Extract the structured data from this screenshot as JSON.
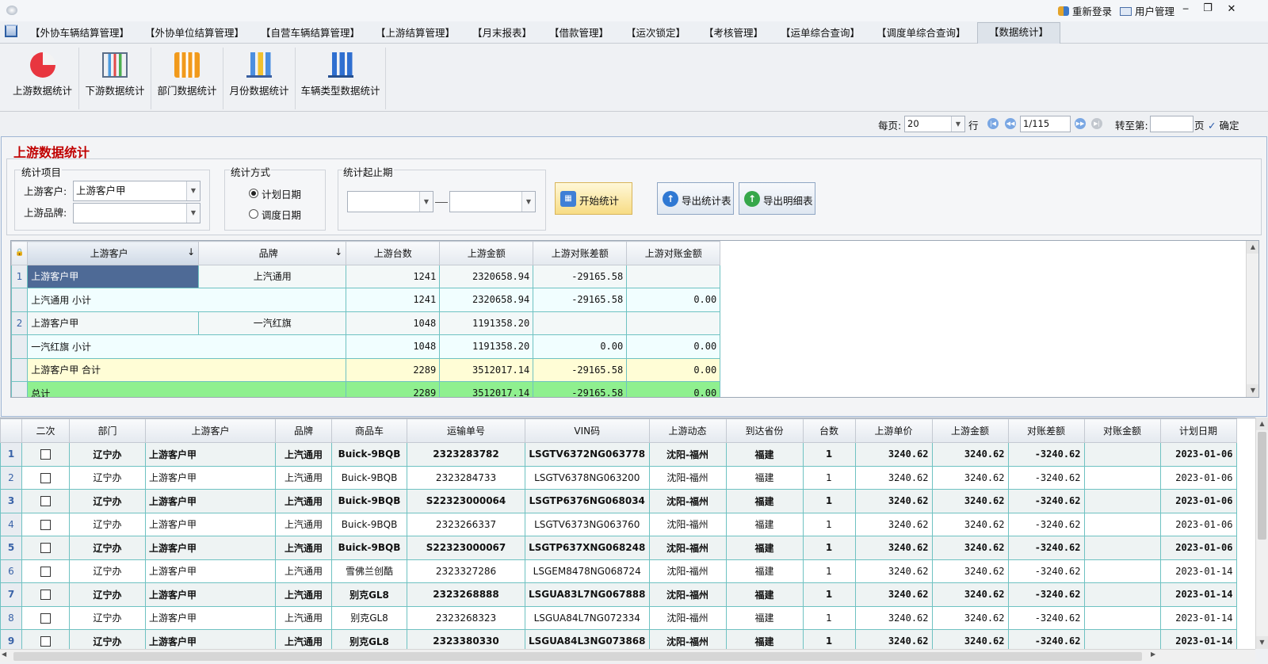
{
  "titlebar": {
    "relogin": "重新登录",
    "user_mgmt": "用户管理",
    "minimize": "─",
    "restore": "❐",
    "close": "✕"
  },
  "menu": [
    "【外协车辆结算管理】",
    "【外协单位结算管理】",
    "【自营车辆结算管理】",
    "【上游结算管理】",
    "【月末报表】",
    "【借款管理】",
    "【运次锁定】",
    "【考核管理】",
    "【运单综合查询】",
    "【调度单综合查询】",
    "【数据统计】"
  ],
  "ribbon": [
    {
      "label": "上游数据统计",
      "icon": "pie-chart-icon"
    },
    {
      "label": "下游数据统计",
      "icon": "bar-chart-icon"
    },
    {
      "label": "部门数据统计",
      "icon": "orange-bar-chart-icon"
    },
    {
      "label": "月份数据统计",
      "icon": "column-chart-icon"
    },
    {
      "label": "车辆类型数据统计",
      "icon": "blue-column-chart-icon"
    }
  ],
  "pager": {
    "per_page_label": "每页:",
    "per_page_value": "20",
    "rows_label": "行",
    "page_value": "1/115",
    "goto_label": "转至第:",
    "goto_value": "",
    "page_unit": "页",
    "confirm": "确定"
  },
  "panel": {
    "title": "上游数据统计",
    "group_items": "统计项目",
    "customer_label": "上游客户:",
    "customer_value": "上游客户甲",
    "brand_label": "上游品牌:",
    "brand_value": "",
    "group_method": "统计方式",
    "radio_plan": "计划日期",
    "radio_dispatch": "调度日期",
    "selected_method": "计划日期",
    "group_period": "统计起止期",
    "start_date": "",
    "end_date": "",
    "btn_start": "开始统计",
    "btn_export_summary": "导出统计表",
    "btn_export_detail": "导出明细表"
  },
  "summary": {
    "headers": [
      "上游客户",
      "品牌",
      "上游台数",
      "上游金额",
      "上游对账差额",
      "上游对账金额"
    ],
    "rows": [
      {
        "num": "1",
        "type": "data",
        "customer": "上游客户甲",
        "brand": "上汽通用",
        "count": "1241",
        "amount": "2320658.94",
        "diff": "-29165.58",
        "recon": ""
      },
      {
        "num": "",
        "type": "sub",
        "label": "上汽通用 小计",
        "count": "1241",
        "amount": "2320658.94",
        "diff": "-29165.58",
        "recon": "0.00"
      },
      {
        "num": "2",
        "type": "data",
        "customer": "上游客户甲",
        "brand": "一汽红旗",
        "count": "1048",
        "amount": "1191358.20",
        "diff": "",
        "recon": ""
      },
      {
        "num": "",
        "type": "sub",
        "label": "一汽红旗 小计",
        "count": "1048",
        "amount": "1191358.20",
        "diff": "0.00",
        "recon": "0.00"
      },
      {
        "num": "",
        "type": "total",
        "label": "上游客户甲 合计",
        "count": "2289",
        "amount": "3512017.14",
        "diff": "-29165.58",
        "recon": "0.00"
      },
      {
        "num": "",
        "type": "grand",
        "label": "总计",
        "count": "2289",
        "amount": "3512017.14",
        "diff": "-29165.58",
        "recon": "0.00"
      }
    ]
  },
  "detail": {
    "headers": [
      "二次",
      "部门",
      "上游客户",
      "品牌",
      "商品车",
      "运输单号",
      "VIN码",
      "上游动态",
      "到达省份",
      "台数",
      "上游单价",
      "上游金额",
      "对账差额",
      "对账金额",
      "计划日期"
    ],
    "rows": [
      {
        "n": "1",
        "dept": "辽宁办",
        "cust": "上游客户甲",
        "brand": "上汽通用",
        "car": "Buick-9BQB",
        "order": "2323283782",
        "vin": "LSGTV6372NG063778",
        "route": "沈阳-福州",
        "prov": "福建",
        "qty": "1",
        "price": "3240.62",
        "amt": "3240.62",
        "diff": "-3240.62",
        "recon": "",
        "date": "2023-01-06"
      },
      {
        "n": "2",
        "dept": "辽宁办",
        "cust": "上游客户甲",
        "brand": "上汽通用",
        "car": "Buick-9BQB",
        "order": "2323284733",
        "vin": "LSGTV6378NG063200",
        "route": "沈阳-福州",
        "prov": "福建",
        "qty": "1",
        "price": "3240.62",
        "amt": "3240.62",
        "diff": "-3240.62",
        "recon": "",
        "date": "2023-01-06"
      },
      {
        "n": "3",
        "dept": "辽宁办",
        "cust": "上游客户甲",
        "brand": "上汽通用",
        "car": "Buick-9BQB",
        "order": "S22323000064",
        "vin": "LSGTP6376NG068034",
        "route": "沈阳-福州",
        "prov": "福建",
        "qty": "1",
        "price": "3240.62",
        "amt": "3240.62",
        "diff": "-3240.62",
        "recon": "",
        "date": "2023-01-06"
      },
      {
        "n": "4",
        "dept": "辽宁办",
        "cust": "上游客户甲",
        "brand": "上汽通用",
        "car": "Buick-9BQB",
        "order": "2323266337",
        "vin": "LSGTV6373NG063760",
        "route": "沈阳-福州",
        "prov": "福建",
        "qty": "1",
        "price": "3240.62",
        "amt": "3240.62",
        "diff": "-3240.62",
        "recon": "",
        "date": "2023-01-06"
      },
      {
        "n": "5",
        "dept": "辽宁办",
        "cust": "上游客户甲",
        "brand": "上汽通用",
        "car": "Buick-9BQB",
        "order": "S22323000067",
        "vin": "LSGTP637XNG068248",
        "route": "沈阳-福州",
        "prov": "福建",
        "qty": "1",
        "price": "3240.62",
        "amt": "3240.62",
        "diff": "-3240.62",
        "recon": "",
        "date": "2023-01-06"
      },
      {
        "n": "6",
        "dept": "辽宁办",
        "cust": "上游客户甲",
        "brand": "上汽通用",
        "car": "雪佛兰创酷",
        "order": "2323327286",
        "vin": "LSGEM8478NG068724",
        "route": "沈阳-福州",
        "prov": "福建",
        "qty": "1",
        "price": "3240.62",
        "amt": "3240.62",
        "diff": "-3240.62",
        "recon": "",
        "date": "2023-01-14"
      },
      {
        "n": "7",
        "dept": "辽宁办",
        "cust": "上游客户甲",
        "brand": "上汽通用",
        "car": "别克GL8",
        "order": "2323268888",
        "vin": "LSGUA83L7NG067888",
        "route": "沈阳-福州",
        "prov": "福建",
        "qty": "1",
        "price": "3240.62",
        "amt": "3240.62",
        "diff": "-3240.62",
        "recon": "",
        "date": "2023-01-14"
      },
      {
        "n": "8",
        "dept": "辽宁办",
        "cust": "上游客户甲",
        "brand": "上汽通用",
        "car": "别克GL8",
        "order": "2323268323",
        "vin": "LSGUA84L7NG072334",
        "route": "沈阳-福州",
        "prov": "福建",
        "qty": "1",
        "price": "3240.62",
        "amt": "3240.62",
        "diff": "-3240.62",
        "recon": "",
        "date": "2023-01-14"
      },
      {
        "n": "9",
        "dept": "辽宁办",
        "cust": "上游客户甲",
        "brand": "上汽通用",
        "car": "别克GL8",
        "order": "2323380330",
        "vin": "LSGUA84L3NG073868",
        "route": "沈阳-福州",
        "prov": "福建",
        "qty": "1",
        "price": "3240.62",
        "amt": "3240.62",
        "diff": "-3240.62",
        "recon": "",
        "date": "2023-01-14"
      }
    ]
  }
}
